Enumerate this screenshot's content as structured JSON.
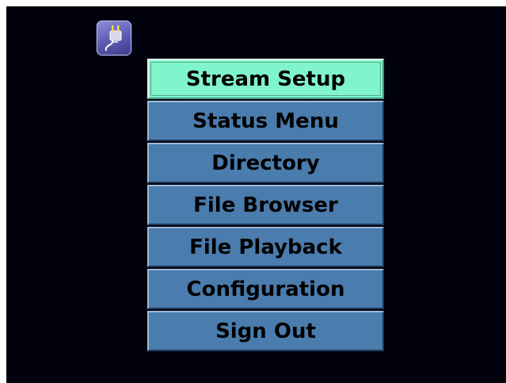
{
  "toolbar": {
    "power_icon": "power-plug-icon"
  },
  "menu": {
    "selected_index": 0,
    "items": [
      {
        "label": "Stream Setup"
      },
      {
        "label": "Status Menu"
      },
      {
        "label": "Directory"
      },
      {
        "label": "File Browser"
      },
      {
        "label": "File Playback"
      },
      {
        "label": "Configuration"
      },
      {
        "label": "Sign Out"
      }
    ]
  },
  "colors": {
    "background": "#02020f",
    "menu_item": "#4a7cad",
    "menu_item_selected": "#80f5cc"
  }
}
